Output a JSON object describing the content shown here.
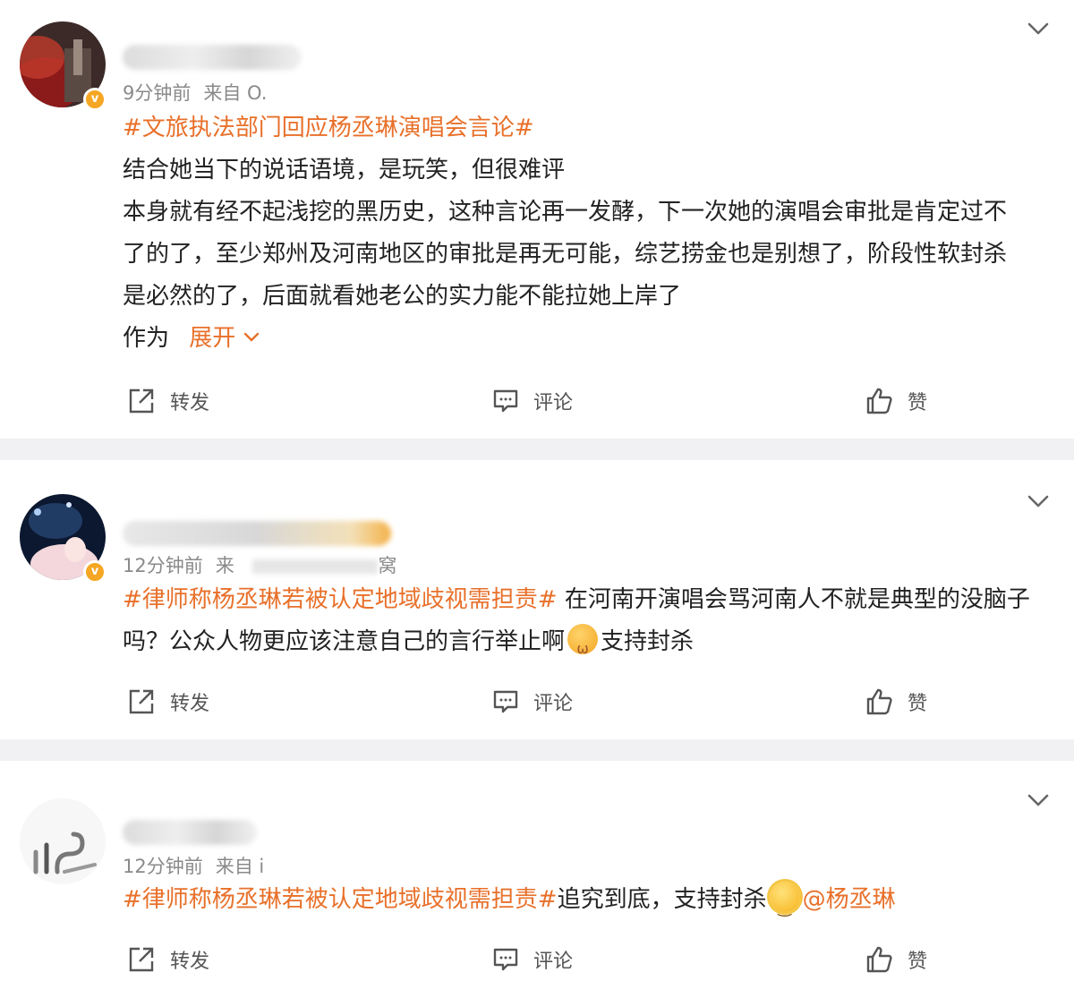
{
  "posts": [
    {
      "time": "9分钟前",
      "source": "来自 O.",
      "topic": "#文旅执法部门回应杨丞琳演唱会言论#",
      "lines": [
        "结合她当下的说话语境，是玩笑，但很难评",
        "本身就有经不起浅挖的黑历史，这种言论再一发酵，下一次她的演唱会审批是肯定过不",
        "了的了，至少郑州及河南地区的审批是再无可能，综艺捞金也是别想了，阶段性软封杀",
        "是必然的了，后面就看她老公的实力能不能拉她上岸了"
      ],
      "truncated_text": "作为",
      "expand_label": "展开",
      "actions": {
        "repost": "转发",
        "comment": "评论",
        "like": "赞"
      }
    },
    {
      "time": "12分钟前",
      "source": "来",
      "source_tail": "窝",
      "topic": "#律师称杨丞琳若被认定地域歧视需担责#",
      "text_a": " 在河南开演唱会骂河南人不就是典型的没脑子",
      "text_b": "吗？公众人物更应该注意自己的言行举止啊",
      "text_c": "支持封杀",
      "actions": {
        "repost": "转发",
        "comment": "评论",
        "like": "赞"
      }
    },
    {
      "time": "12分钟前",
      "source": "来自 i",
      "topic": "#律师称杨丞琳若被认定地域歧视需担责#",
      "text_a": "追究到底，支持封杀",
      "mention": "@杨丞琳",
      "actions": {
        "repost": "转发",
        "comment": "评论",
        "like": "赞"
      }
    }
  ],
  "icons": {
    "more": "chevron-down-icon",
    "repost": "share-icon",
    "comment": "comment-icon",
    "like": "thumbs-up-icon",
    "verified": "verified-badge-icon"
  },
  "colors": {
    "accent": "#e8702a",
    "meta": "#8a8a8a",
    "separator": "#f1f1f3",
    "badge": "#f5a623"
  }
}
